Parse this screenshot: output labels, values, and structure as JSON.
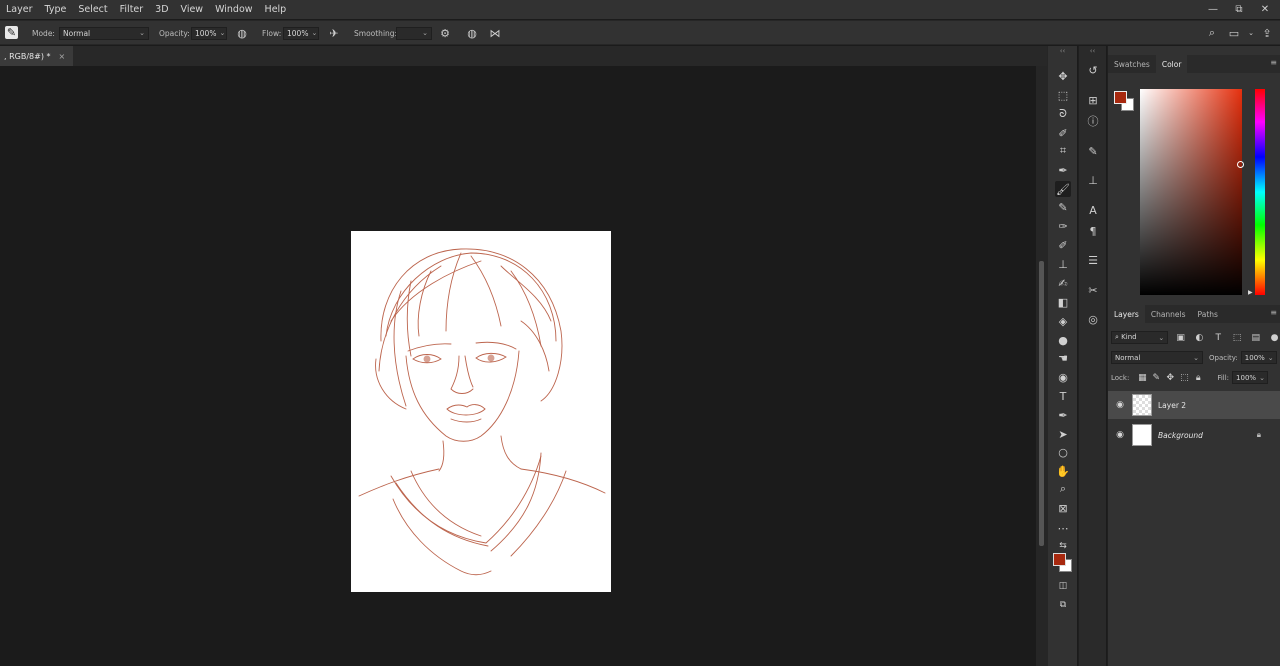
{
  "menu": [
    "Layer",
    "Type",
    "Select",
    "Filter",
    "3D",
    "View",
    "Window",
    "Help"
  ],
  "window_controls": {
    "minimize": "—",
    "restore": "⧉",
    "close": "✕"
  },
  "options": {
    "mode_label": "Mode:",
    "mode_value": "Normal",
    "opacity_label": "Opacity:",
    "opacity_value": "100%",
    "flow_label": "Flow:",
    "flow_value": "100%",
    "smoothing_label": "Smoothing:",
    "smoothing_value": ""
  },
  "document": {
    "tab_title": ", RGB/8#) *",
    "close": "×"
  },
  "tools": [
    "move-icon",
    "marquee-icon",
    "lasso-icon",
    "quick-select-icon",
    "crop-icon",
    "eyedropper-icon",
    "brush-icon",
    "pencil-icon",
    "clone-brush-icon",
    "history-brush-icon",
    "stamp-icon",
    "mixer-brush-icon",
    "eraser-icon",
    "paint-bucket-icon",
    "blur-icon",
    "smudge-icon",
    "dodge-icon",
    "type-icon",
    "pen-icon",
    "path-select-icon",
    "ellipse-icon",
    "hand-icon",
    "zoom-icon",
    "frame-icon",
    "more-icon"
  ],
  "colors": {
    "foreground": "#a8290f",
    "background": "#ffffff",
    "ui_bg": "#323232",
    "canvas_bg": "#1b1b1b"
  },
  "color_panel": {
    "tabs": [
      "Swatches",
      "Color"
    ],
    "active_tab": "Color"
  },
  "layers_panel": {
    "tabs": [
      "Layers",
      "Channels",
      "Paths"
    ],
    "active_tab": "Layers",
    "kind_label": "Kind",
    "blend_mode": "Normal",
    "opacity_label": "Opacity:",
    "opacity_value": "100%",
    "lock_label": "Lock:",
    "fill_label": "Fill:",
    "fill_value": "100%",
    "layers": [
      {
        "name": "Layer 2",
        "selected": true,
        "locked": false
      },
      {
        "name": "Background",
        "selected": false,
        "locked": true
      }
    ]
  }
}
